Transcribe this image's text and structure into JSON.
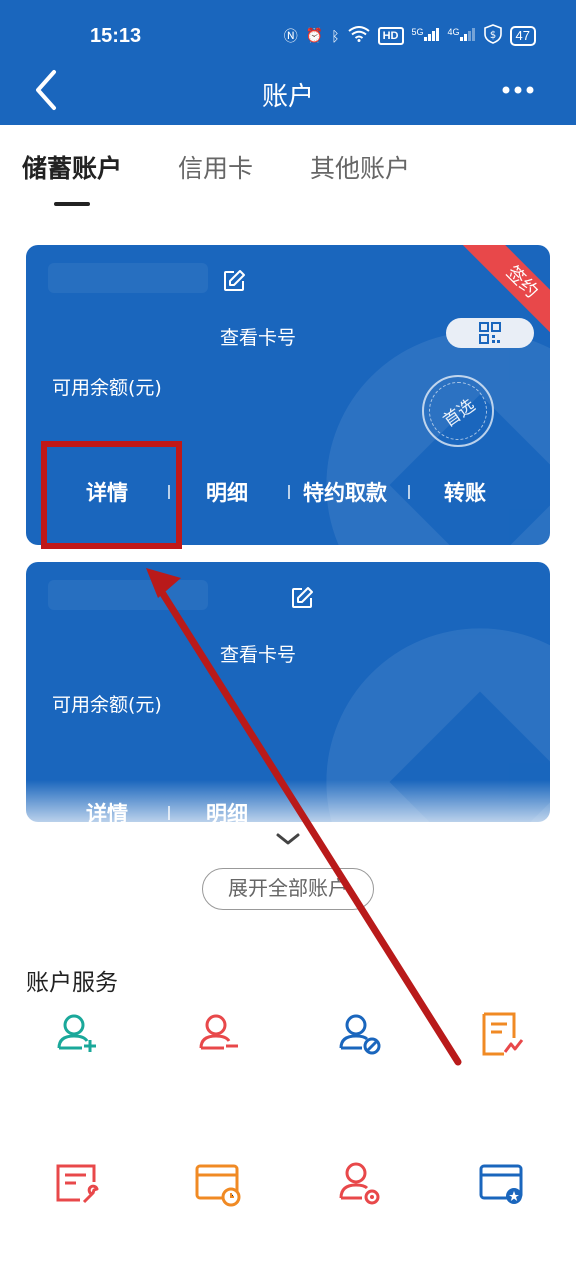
{
  "status": {
    "time": "15:13",
    "battery": "47",
    "hd": "HD",
    "net5g": "5G",
    "net4g": "4G"
  },
  "header": {
    "title": "账户"
  },
  "tabs": [
    {
      "label": "储蓄账户",
      "active": true
    },
    {
      "label": "信用卡",
      "active": false
    },
    {
      "label": "其他账户",
      "active": false
    }
  ],
  "cards": [
    {
      "view_card_no": "查看卡号",
      "balance_label": "可用余额(元)",
      "ribbon": "签约",
      "preferred": "首选",
      "actions": [
        "详情",
        "明细",
        "特约取款",
        "转账"
      ]
    },
    {
      "view_card_no": "查看卡号",
      "balance_label": "可用余额(元)",
      "actions": [
        "详情",
        "明细"
      ]
    }
  ],
  "expand_all": "展开全部账户",
  "services": {
    "title": "账户服务"
  },
  "colors": {
    "brand": "#1a66bd",
    "highlight": "#c01818",
    "teal": "#1aa89a",
    "red": "#e8484a",
    "blue": "#1a66bd",
    "orange": "#f08a24"
  }
}
